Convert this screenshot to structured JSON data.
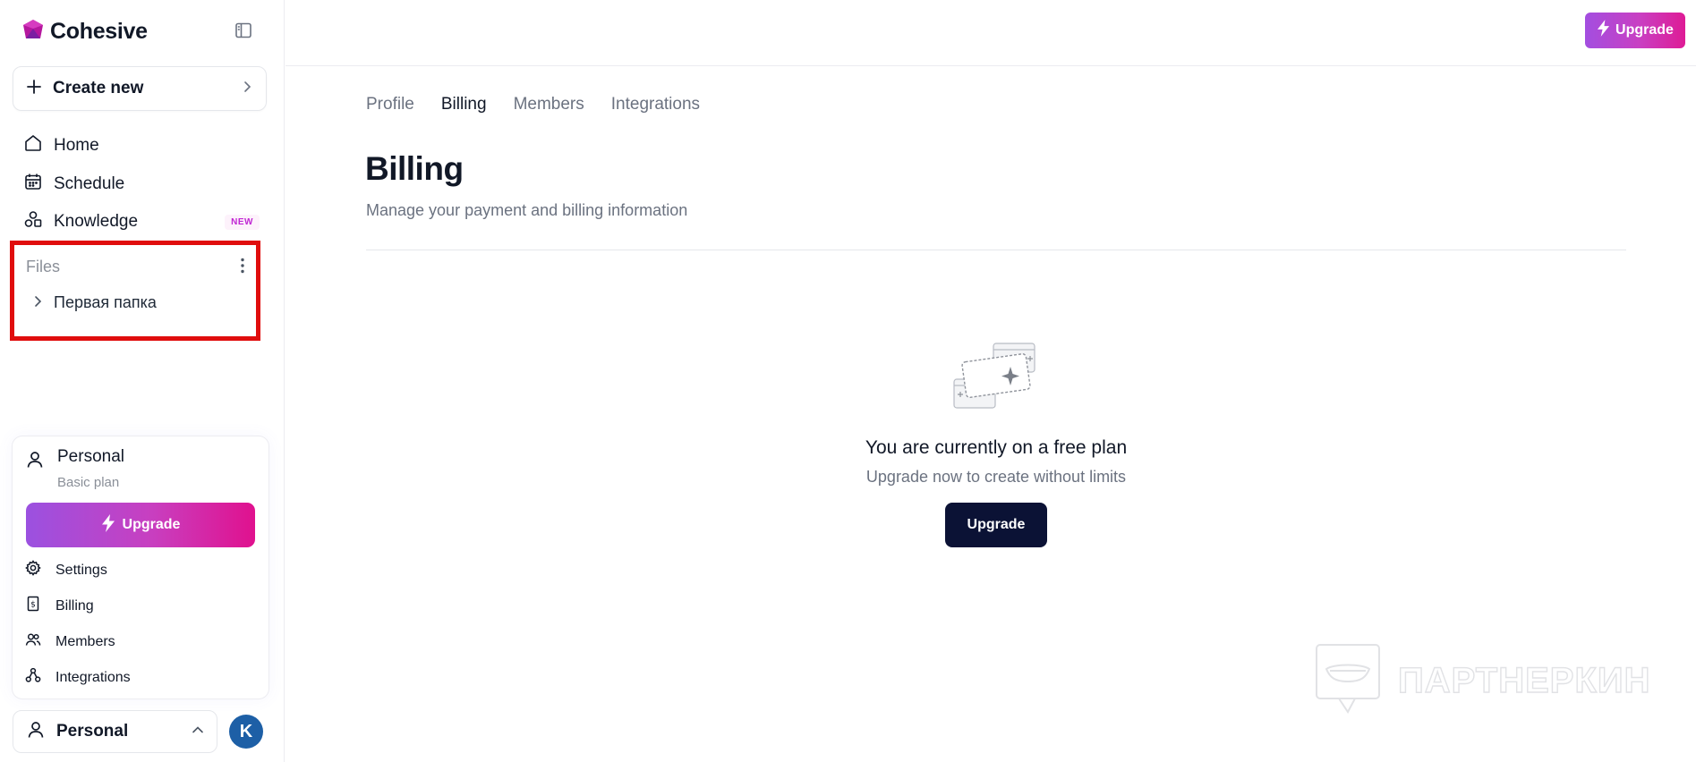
{
  "brand": {
    "name": "Cohesive"
  },
  "sidebar": {
    "create_new": "Create new",
    "nav": [
      {
        "label": "Home",
        "icon": "home-icon"
      },
      {
        "label": "Schedule",
        "icon": "calendar-icon"
      },
      {
        "label": "Knowledge",
        "icon": "knowledge-icon",
        "badge": "NEW"
      }
    ],
    "files": {
      "title": "Files",
      "folders": [
        {
          "label": "Первая папка"
        }
      ]
    },
    "account": {
      "name": "Personal",
      "plan": "Basic plan",
      "upgrade": "Upgrade",
      "menu": [
        {
          "label": "Settings",
          "icon": "gear-icon"
        },
        {
          "label": "Billing",
          "icon": "receipt-icon"
        },
        {
          "label": "Members",
          "icon": "users-icon"
        },
        {
          "label": "Integrations",
          "icon": "integrations-icon"
        }
      ]
    },
    "workspace": "Personal",
    "avatar_initial": "K"
  },
  "topbar": {
    "upgrade": "Upgrade"
  },
  "tabs": [
    {
      "label": "Profile",
      "active": false
    },
    {
      "label": "Billing",
      "active": true
    },
    {
      "label": "Members",
      "active": false
    },
    {
      "label": "Integrations",
      "active": false
    }
  ],
  "page": {
    "title": "Billing",
    "subtitle": "Manage your payment and billing information"
  },
  "empty_state": {
    "title": "You are currently on a free plan",
    "subtitle": "Upgrade now to create without limits",
    "button": "Upgrade"
  },
  "watermark": {
    "text": "ПАРТНЕРКИН"
  },
  "colors": {
    "accent_gradient_start": "#9b51e0",
    "accent_gradient_end": "#e0118e",
    "dark_button": "#0b1235",
    "highlight_border": "#e00d0d",
    "avatar": "#1d5fa6"
  }
}
